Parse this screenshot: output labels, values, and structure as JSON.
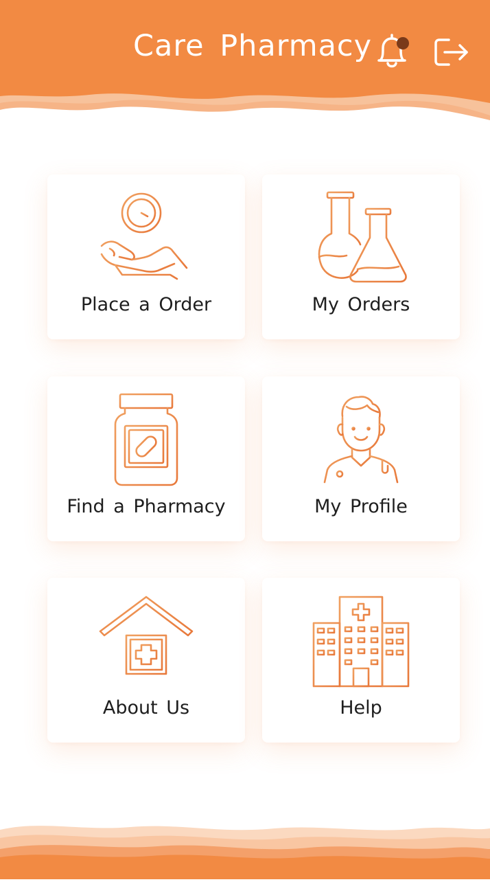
{
  "header": {
    "title": "Care Pharmacy",
    "notification_icon": "bell-icon",
    "notification_badge": true,
    "logout_icon": "logout-icon"
  },
  "menu": [
    {
      "label": "Place a Order",
      "icon": "hand-clock-icon"
    },
    {
      "label": "My Orders",
      "icon": "flasks-icon"
    },
    {
      "label": "Find a Pharmacy",
      "icon": "medicine-jar-icon"
    },
    {
      "label": "My Profile",
      "icon": "doctor-icon"
    },
    {
      "label": "About Us",
      "icon": "clinic-house-icon"
    },
    {
      "label": "Help",
      "icon": "hospital-icon"
    }
  ],
  "colors": {
    "primary": "#F28A43",
    "light": "#F7B68A",
    "badge": "#7A3A1A",
    "text": "#1E1E1E"
  }
}
